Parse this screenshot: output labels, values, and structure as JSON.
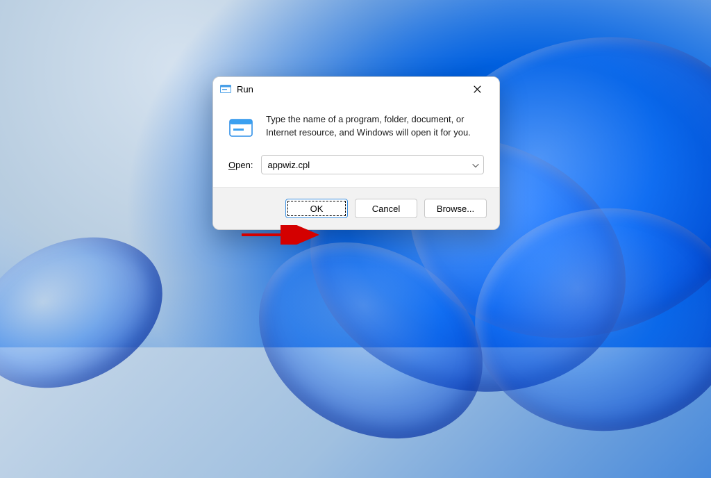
{
  "dialog": {
    "title": "Run",
    "instruction": "Type the name of a program, folder, document, or Internet resource, and Windows will open it for you.",
    "open_label_underlined": "O",
    "open_label_rest": "pen:",
    "input_value": "appwiz.cpl",
    "buttons": {
      "ok": "OK",
      "cancel": "Cancel",
      "browse": "Browse..."
    }
  }
}
